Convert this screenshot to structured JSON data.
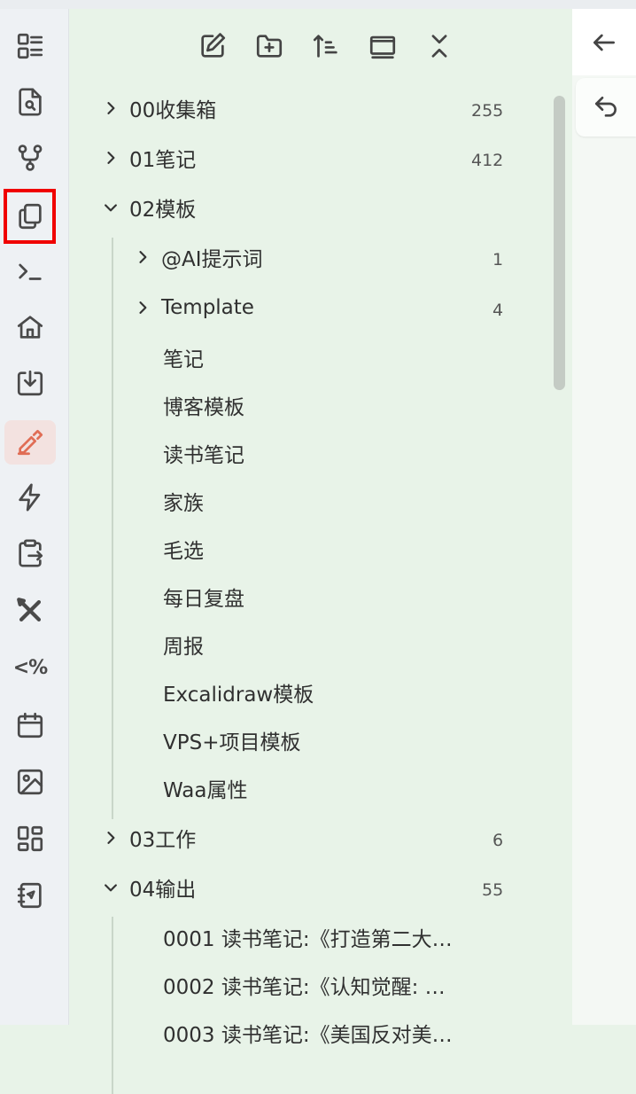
{
  "ribbon": {
    "icons": [
      "file-list-icon",
      "search-file-icon",
      "graph-icon",
      "copy-files-icon",
      "terminal-icon",
      "home-icon",
      "download-icon",
      "highlighter-icon",
      "bolt-icon",
      "clipboard-export-icon",
      "tools-icon",
      "percent-icon",
      "calendar-icon",
      "image-icon",
      "dashboard-icon",
      "notebook-icon"
    ],
    "percent_label": "<%"
  },
  "nav_header": [
    "new-note-icon",
    "new-folder-icon",
    "sort-icon",
    "collapse-view-icon",
    "collapse-all-icon"
  ],
  "tree": {
    "f00": {
      "label": "00收集箱",
      "count": "255"
    },
    "f01": {
      "label": "01笔记",
      "count": "412"
    },
    "f02": {
      "label": "02模板"
    },
    "ai": {
      "label": "@AI提示词",
      "count": "1"
    },
    "template": {
      "label": "Template",
      "count": "4"
    },
    "t1": "笔记",
    "t2": "博客模板",
    "t3": "读书笔记",
    "t4": "家族",
    "t5": "毛选",
    "t6": "每日复盘",
    "t7": "周报",
    "t8": "Excalidraw模板",
    "t9": "VPS+项目模板",
    "t10": "Waa属性",
    "f03": {
      "label": "03工作",
      "count": "6"
    },
    "f04": {
      "label": "04输出",
      "count": "55"
    },
    "o1": "0001 读书笔记:《打造第二大…",
    "o2": "0002 读书笔记:《认知觉醒: …",
    "o3": "0003 读书笔记:《美国反对美…"
  }
}
